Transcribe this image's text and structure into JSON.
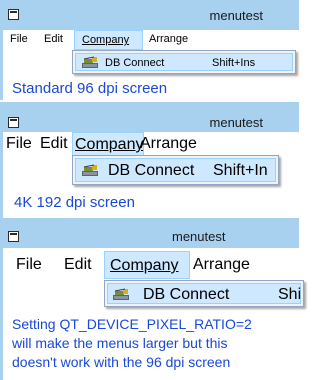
{
  "windows": [
    {
      "title": "menutest",
      "menu": [
        "File",
        "Edit",
        "Company",
        "Arrange"
      ],
      "dropdown": {
        "item": "DB Connect",
        "shortcut": "Shift+Ins"
      },
      "caption": "Standard 96 dpi screen"
    },
    {
      "title": "menutest",
      "menu": [
        "File",
        "Edit",
        "Company",
        "Arrange"
      ],
      "dropdown": {
        "item": "DB Connect",
        "shortcut": "Shift+In"
      },
      "caption": "4K 192 dpi screen"
    },
    {
      "title": "menutest",
      "menu": [
        "File",
        "Edit",
        "Company",
        "Arrange"
      ],
      "dropdown": {
        "item": "DB Connect",
        "shortcut": "Shi"
      },
      "caption_lines": [
        "Setting QT_DEVICE_PIXEL_RATIO=2",
        "will make the menus larger but this",
        "doesn't work with the 96 dpi screen"
      ]
    }
  ],
  "colors": {
    "titlebar": "#a8d0ef",
    "caption_text": "#1a48d8",
    "menu_highlight": "#cde8ff"
  },
  "icons": [
    "app-icon",
    "db-connect-icon"
  ]
}
